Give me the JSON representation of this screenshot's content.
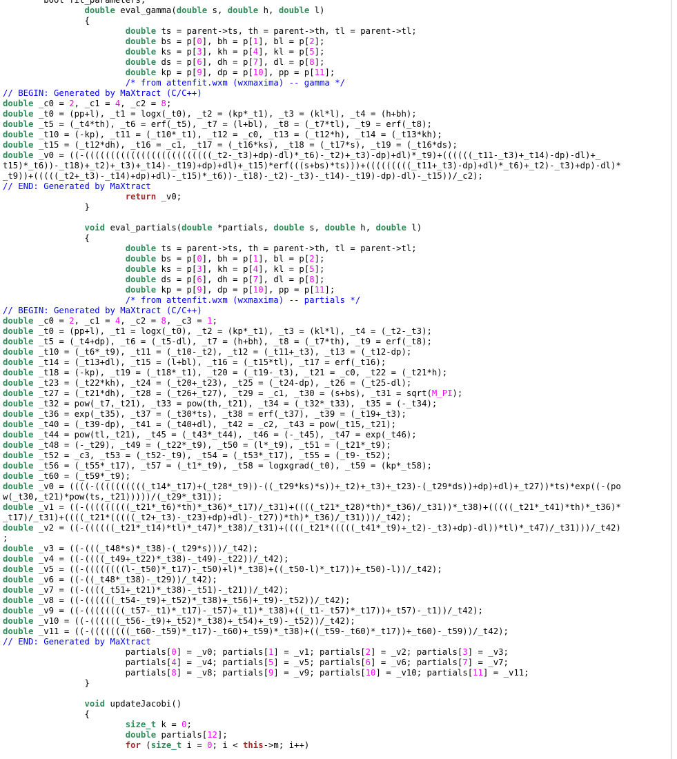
{
  "editor": {
    "lines": [
      [
        [
          "        bool fit_parameters;",
          ""
        ]
      ],
      [
        [
          "                ",
          ""
        ],
        [
          "double",
          "kw"
        ],
        [
          " eval_gamma(",
          ""
        ],
        [
          "double",
          "kw"
        ],
        [
          " s, ",
          ""
        ],
        [
          "double",
          "kw"
        ],
        [
          " h, ",
          ""
        ],
        [
          "double",
          "kw"
        ],
        [
          " l)",
          ""
        ]
      ],
      [
        [
          "                {",
          ""
        ]
      ],
      [
        [
          "                        ",
          ""
        ],
        [
          "double",
          "kw"
        ],
        [
          " ts = parent->ts, th = parent->th, tl = parent->tl;",
          ""
        ]
      ],
      [
        [
          "                        ",
          ""
        ],
        [
          "double",
          "kw"
        ],
        [
          " bs = p[",
          ""
        ],
        [
          "0",
          "num"
        ],
        [
          "], bh = p[",
          ""
        ],
        [
          "1",
          "num"
        ],
        [
          "], bl = p[",
          ""
        ],
        [
          "2",
          "num"
        ],
        [
          "];",
          ""
        ]
      ],
      [
        [
          "                        ",
          ""
        ],
        [
          "double",
          "kw"
        ],
        [
          " ks = p[",
          ""
        ],
        [
          "3",
          "num"
        ],
        [
          "], kh = p[",
          ""
        ],
        [
          "4",
          "num"
        ],
        [
          "], kl = p[",
          ""
        ],
        [
          "5",
          "num"
        ],
        [
          "];",
          ""
        ]
      ],
      [
        [
          "                        ",
          ""
        ],
        [
          "double",
          "kw"
        ],
        [
          " ds = p[",
          ""
        ],
        [
          "6",
          "num"
        ],
        [
          "], dh = p[",
          ""
        ],
        [
          "7",
          "num"
        ],
        [
          "], dl = p[",
          ""
        ],
        [
          "8",
          "num"
        ],
        [
          "];",
          ""
        ]
      ],
      [
        [
          "                        ",
          ""
        ],
        [
          "double",
          "kw"
        ],
        [
          " kp = p[",
          ""
        ],
        [
          "9",
          "num"
        ],
        [
          "], dp = p[",
          ""
        ],
        [
          "10",
          "num"
        ],
        [
          "], pp = p[",
          ""
        ],
        [
          "11",
          "num"
        ],
        [
          "];",
          ""
        ]
      ],
      [
        [
          "                        ",
          ""
        ],
        [
          "/* from attenfit.wxm (wxmaxima) -- gamma */",
          "cm"
        ]
      ],
      [
        [
          "// BEGIN: Generated by MaXtract (C/C++)",
          "cm"
        ]
      ],
      [
        [
          "double",
          "kw"
        ],
        [
          " _c0 = ",
          ""
        ],
        [
          "2",
          "num"
        ],
        [
          ", _c1 = ",
          ""
        ],
        [
          "4",
          "num"
        ],
        [
          ", _c2 = ",
          ""
        ],
        [
          "8",
          "num"
        ],
        [
          ";",
          ""
        ]
      ],
      [
        [
          "double",
          "kw"
        ],
        [
          " _t0 = (pp+l), _t1 = logx(_t0), _t2 = (kp*_t1), _t3 = (kl*l), _t4 = (h+bh);",
          ""
        ]
      ],
      [
        [
          "double",
          "kw"
        ],
        [
          " _t5 = (_t4*th), _t6 = erf(_t5), _t7 = (l+bl), _t8 = (_t7*tl), _t9 = erf(_t8);",
          ""
        ]
      ],
      [
        [
          "double",
          "kw"
        ],
        [
          " _t10 = (-kp), _t11 = (_t10*_t1), _t12 = _c0, _t13 = (_t12*h), _t14 = (_t13*kh);",
          ""
        ]
      ],
      [
        [
          "double",
          "kw"
        ],
        [
          " _t15 = (_t12*dh), _t16 = _c1, _t17 = (_t16*ks), _t18 = (_t17*s), _t19 = (_t16*ds);",
          ""
        ]
      ],
      [
        [
          "double",
          "kw"
        ],
        [
          " _v0 = ((-(((((((((((((((((((((((((_t2-_t3)+dp)-dl)*_t6)-_t2)+_t3)-dp)+dl)*_t9)+((((((_t11-_t3)+_t14)-dp)-dl)+_",
          ""
        ]
      ],
      [
        [
          "t15)*_t6))-_t18)+_t2)+_t3)+_t14)-_t19)+dp)+dl)+_t15)*erf(((s+bs)*ts)))+(((((((((_t11+_t3)-dp)+dl)*_t6)+_t2)-_t3)+dp)-dl)*",
          ""
        ]
      ],
      [
        [
          "_t9))+(((((_t2+_t3)-_t14)+dp)+dl)-_t15)*_t6))-_t18)-_t2)-_t3)-_t14)-_t19)-dp)-dl)-_t15))/_c2);",
          ""
        ]
      ],
      [
        [
          "// END: Generated by MaXtract",
          "cm"
        ]
      ],
      [
        [
          "                        ",
          ""
        ],
        [
          "return",
          "ctl"
        ],
        [
          " _v0;",
          ""
        ]
      ],
      [
        [
          "                }",
          ""
        ]
      ],
      [
        [
          "",
          ""
        ]
      ],
      [
        [
          "                ",
          ""
        ],
        [
          "void",
          "kw"
        ],
        [
          " eval_partials(",
          ""
        ],
        [
          "double",
          "kw"
        ],
        [
          " *partials, ",
          ""
        ],
        [
          "double",
          "kw"
        ],
        [
          " s, ",
          ""
        ],
        [
          "double",
          "kw"
        ],
        [
          " h, ",
          ""
        ],
        [
          "double",
          "kw"
        ],
        [
          " l)",
          ""
        ]
      ],
      [
        [
          "                {",
          ""
        ]
      ],
      [
        [
          "                        ",
          ""
        ],
        [
          "double",
          "kw"
        ],
        [
          " ts = parent->ts, th = parent->th, tl = parent->tl;",
          ""
        ]
      ],
      [
        [
          "                        ",
          ""
        ],
        [
          "double",
          "kw"
        ],
        [
          " bs = p[",
          ""
        ],
        [
          "0",
          "num"
        ],
        [
          "], bh = p[",
          ""
        ],
        [
          "1",
          "num"
        ],
        [
          "], bl = p[",
          ""
        ],
        [
          "2",
          "num"
        ],
        [
          "];",
          ""
        ]
      ],
      [
        [
          "                        ",
          ""
        ],
        [
          "double",
          "kw"
        ],
        [
          " ks = p[",
          ""
        ],
        [
          "3",
          "num"
        ],
        [
          "], kh = p[",
          ""
        ],
        [
          "4",
          "num"
        ],
        [
          "], kl = p[",
          ""
        ],
        [
          "5",
          "num"
        ],
        [
          "];",
          ""
        ]
      ],
      [
        [
          "                        ",
          ""
        ],
        [
          "double",
          "kw"
        ],
        [
          " ds = p[",
          ""
        ],
        [
          "6",
          "num"
        ],
        [
          "], dh = p[",
          ""
        ],
        [
          "7",
          "num"
        ],
        [
          "], dl = p[",
          ""
        ],
        [
          "8",
          "num"
        ],
        [
          "];",
          ""
        ]
      ],
      [
        [
          "                        ",
          ""
        ],
        [
          "double",
          "kw"
        ],
        [
          " kp = p[",
          ""
        ],
        [
          "9",
          "num"
        ],
        [
          "], dp = p[",
          ""
        ],
        [
          "10",
          "num"
        ],
        [
          "], pp = p[",
          ""
        ],
        [
          "11",
          "num"
        ],
        [
          "];",
          ""
        ]
      ],
      [
        [
          "                        ",
          ""
        ],
        [
          "/* from attenfit.wxm (wxmaxima) -- partials */",
          "cm"
        ]
      ],
      [
        [
          "// BEGIN: Generated by MaXtract (C/C++)",
          "cm"
        ]
      ],
      [
        [
          "double",
          "kw"
        ],
        [
          " _c0 = ",
          ""
        ],
        [
          "2",
          "num"
        ],
        [
          ", _c1 = ",
          ""
        ],
        [
          "4",
          "num"
        ],
        [
          ", _c2 = ",
          ""
        ],
        [
          "8",
          "num"
        ],
        [
          ", _c3 = ",
          ""
        ],
        [
          "1",
          "num"
        ],
        [
          ";",
          ""
        ]
      ],
      [
        [
          "double",
          "kw"
        ],
        [
          " _t0 = (pp+l), _t1 = logx(_t0), _t2 = (kp*_t1), _t3 = (kl*l), _t4 = (_t2-_t3);",
          ""
        ]
      ],
      [
        [
          "double",
          "kw"
        ],
        [
          " _t5 = (_t4+dp), _t6 = (_t5-dl), _t7 = (h+bh), _t8 = (_t7*th), _t9 = erf(_t8);",
          ""
        ]
      ],
      [
        [
          "double",
          "kw"
        ],
        [
          " _t10 = (_t6*_t9), _t11 = (_t10-_t2), _t12 = (_t11+_t3), _t13 = (_t12-dp);",
          ""
        ]
      ],
      [
        [
          "double",
          "kw"
        ],
        [
          " _t14 = (_t13+dl), _t15 = (l+bl), _t16 = (_t15*tl), _t17 = erf(_t16);",
          ""
        ]
      ],
      [
        [
          "double",
          "kw"
        ],
        [
          " _t18 = (-kp), _t19 = (_t18*_t1), _t20 = (_t19-_t3), _t21 = _c0, _t22 = (_t21*h);",
          ""
        ]
      ],
      [
        [
          "double",
          "kw"
        ],
        [
          " _t23 = (_t22*kh), _t24 = (_t20+_t23), _t25 = (_t24-dp), _t26 = (_t25-dl);",
          ""
        ]
      ],
      [
        [
          "double",
          "kw"
        ],
        [
          " _t27 = (_t21*dh), _t28 = (_t26+_t27), _t29 = _c1, _t30 = (s+bs), _t31 = sqrt(",
          ""
        ],
        [
          "M_PI",
          "num"
        ],
        [
          ");",
          ""
        ]
      ],
      [
        [
          "double",
          "kw"
        ],
        [
          " _t32 = pow(_t7,_t21), _t33 = pow(th,_t21), _t34 = (_t32*_t33), _t35 = (-_t34);",
          ""
        ]
      ],
      [
        [
          "double",
          "kw"
        ],
        [
          " _t36 = exp(_t35), _t37 = (_t30*ts), _t38 = erf(_t37), _t39 = (_t19+_t3);",
          ""
        ]
      ],
      [
        [
          "double",
          "kw"
        ],
        [
          " _t40 = (_t39-dp), _t41 = (_t40+dl), _t42 = _c2, _t43 = pow(_t15,_t21);",
          ""
        ]
      ],
      [
        [
          "double",
          "kw"
        ],
        [
          " _t44 = pow(tl,_t21), _t45 = (_t43*_t44), _t46 = (-_t45), _t47 = exp(_t46);",
          ""
        ]
      ],
      [
        [
          "double",
          "kw"
        ],
        [
          " _t48 = (-_t29), _t49 = (_t22*_t9), _t50 = (l*_t9), _t51 = (_t21*_t9);",
          ""
        ]
      ],
      [
        [
          "double",
          "kw"
        ],
        [
          " _t52 = _c3, _t53 = (_t52-_t9), _t54 = (_t53*_t17), _t55 = (_t9-_t52);",
          ""
        ]
      ],
      [
        [
          "double",
          "kw"
        ],
        [
          " _t56 = (_t55*_t17), _t57 = (_t1*_t9), _t58 = logxgrad(_t0), _t59 = (kp*_t58);",
          ""
        ]
      ],
      [
        [
          "double",
          "kw"
        ],
        [
          " _t60 = (_t59*_t9);",
          ""
        ]
      ],
      [
        [
          "double",
          "kw"
        ],
        [
          " _v0 = ((((-((((((((((_t14*_t17)+(_t28*_t9))-((_t29*ks)*s))+_t2)+_t3)+_t23)-(_t29*ds))+dp)+dl)+_t27))*ts)*exp((-(po",
          ""
        ]
      ],
      [
        [
          "w(_t30,_t21)*pow(ts,_t21)))))/(_t29*_t31));",
          ""
        ]
      ],
      [
        [
          "double",
          "kw"
        ],
        [
          " _v1 = ((-(((((((((_t21*_t6)*th)*_t36)*_t17)/_t31)+((((_t21*_t28)*th)*_t36)/_t31))*_t38)+(((((_t21*_t41)*th)*_t36)*",
          ""
        ]
      ],
      [
        [
          "_t17)/_t31)+((((_t21*(((((_t2+_t3)-_t23)+dp)+dl)-_t27))*th)*_t36)/_t31)))/_t42);",
          ""
        ]
      ],
      [
        [
          "double",
          "kw"
        ],
        [
          " _v2 = ((-((((((_t21*_t14)*tl)*_t47)*_t38)/_t31)+((((_t21*(((((_t41*_t9)+_t2)-_t3)+dp)-dl))*tl)*_t47)/_t31)))/_t42)",
          ""
        ]
      ],
      [
        [
          ";",
          ""
        ]
      ],
      [
        [
          "double",
          "kw"
        ],
        [
          " _v3 = ((-(((_t48*s)*_t38)-(_t29*s)))/_t42);",
          ""
        ]
      ],
      [
        [
          "double",
          "kw"
        ],
        [
          " _v4 = ((-((((_t49+_t22)*_t38)-_t49)-_t22))/_t42);",
          ""
        ]
      ],
      [
        [
          "double",
          "kw"
        ],
        [
          " _v5 = ((-((((((((l-_t50)*_t17)-_t50)+l)*_t38)+((_t50-l)*_t17))+_t50)-l))/_t42);",
          ""
        ]
      ],
      [
        [
          "double",
          "kw"
        ],
        [
          " _v6 = ((-((_t48*_t38)-_t29))/_t42);",
          ""
        ]
      ],
      [
        [
          "double",
          "kw"
        ],
        [
          " _v7 = ((-((((_t51+_t21)*_t38)-_t51)-_t21))/_t42);",
          ""
        ]
      ],
      [
        [
          "double",
          "kw"
        ],
        [
          " _v8 = ((-((((((_t54-_t9)+_t52)*_t38)+_t56)+_t9)-_t52))/_t42);",
          ""
        ]
      ],
      [
        [
          "double",
          "kw"
        ],
        [
          " _v9 = ((-((((((((_t57-_t1)*_t17)-_t57)+_t1)*_t38)+((_t1-_t57)*_t17))+_t57)-_t1))/_t42);",
          ""
        ]
      ],
      [
        [
          "double",
          "kw"
        ],
        [
          " _v10 = ((-((((((_t56-_t9)+_t52)*_t38)+_t54)+_t9)-_t52))/_t42);",
          ""
        ]
      ],
      [
        [
          "double",
          "kw"
        ],
        [
          " _v11 = ((-((((((((_t60-_t59)*_t17)-_t60)+_t59)*_t38)+((_t59-_t60)*_t17))+_t60)-_t59))/_t42);",
          ""
        ]
      ],
      [
        [
          "// END: Generated by MaXtract",
          "cm"
        ]
      ],
      [
        [
          "                        partials[",
          ""
        ],
        [
          "0",
          "num"
        ],
        [
          "] = _v0; partials[",
          ""
        ],
        [
          "1",
          "num"
        ],
        [
          "] = _v1; partials[",
          ""
        ],
        [
          "2",
          "num"
        ],
        [
          "] = _v2; partials[",
          ""
        ],
        [
          "3",
          "num"
        ],
        [
          "] = _v3;",
          ""
        ]
      ],
      [
        [
          "                        partials[",
          ""
        ],
        [
          "4",
          "num"
        ],
        [
          "] = _v4; partials[",
          ""
        ],
        [
          "5",
          "num"
        ],
        [
          "] = _v5; partials[",
          ""
        ],
        [
          "6",
          "num"
        ],
        [
          "] = _v6; partials[",
          ""
        ],
        [
          "7",
          "num"
        ],
        [
          "] = _v7;",
          ""
        ]
      ],
      [
        [
          "                        partials[",
          ""
        ],
        [
          "8",
          "num"
        ],
        [
          "] = _v8; partials[",
          ""
        ],
        [
          "9",
          "num"
        ],
        [
          "] = _v9; partials[",
          ""
        ],
        [
          "10",
          "num"
        ],
        [
          "] = _v10; partials[",
          ""
        ],
        [
          "11",
          "num"
        ],
        [
          "] = _v11;",
          ""
        ]
      ],
      [
        [
          "                }",
          ""
        ]
      ],
      [
        [
          "",
          ""
        ]
      ],
      [
        [
          "                ",
          ""
        ],
        [
          "void",
          "kw"
        ],
        [
          " updateJacobi()",
          ""
        ]
      ],
      [
        [
          "                {",
          ""
        ]
      ],
      [
        [
          "                        ",
          ""
        ],
        [
          "size_t",
          "kw"
        ],
        [
          " k = ",
          ""
        ],
        [
          "0",
          "num"
        ],
        [
          ";",
          ""
        ]
      ],
      [
        [
          "                        ",
          ""
        ],
        [
          "double",
          "kw"
        ],
        [
          " partials[",
          ""
        ],
        [
          "12",
          "num"
        ],
        [
          "];",
          ""
        ]
      ],
      [
        [
          "                        ",
          ""
        ],
        [
          "for",
          "ctl"
        ],
        [
          " (",
          ""
        ],
        [
          "size_t",
          "kw"
        ],
        [
          " i = ",
          ""
        ],
        [
          "0",
          "num"
        ],
        [
          "; i < ",
          ""
        ],
        [
          "this",
          "ctl"
        ],
        [
          "->m; i++)",
          ""
        ]
      ]
    ]
  }
}
